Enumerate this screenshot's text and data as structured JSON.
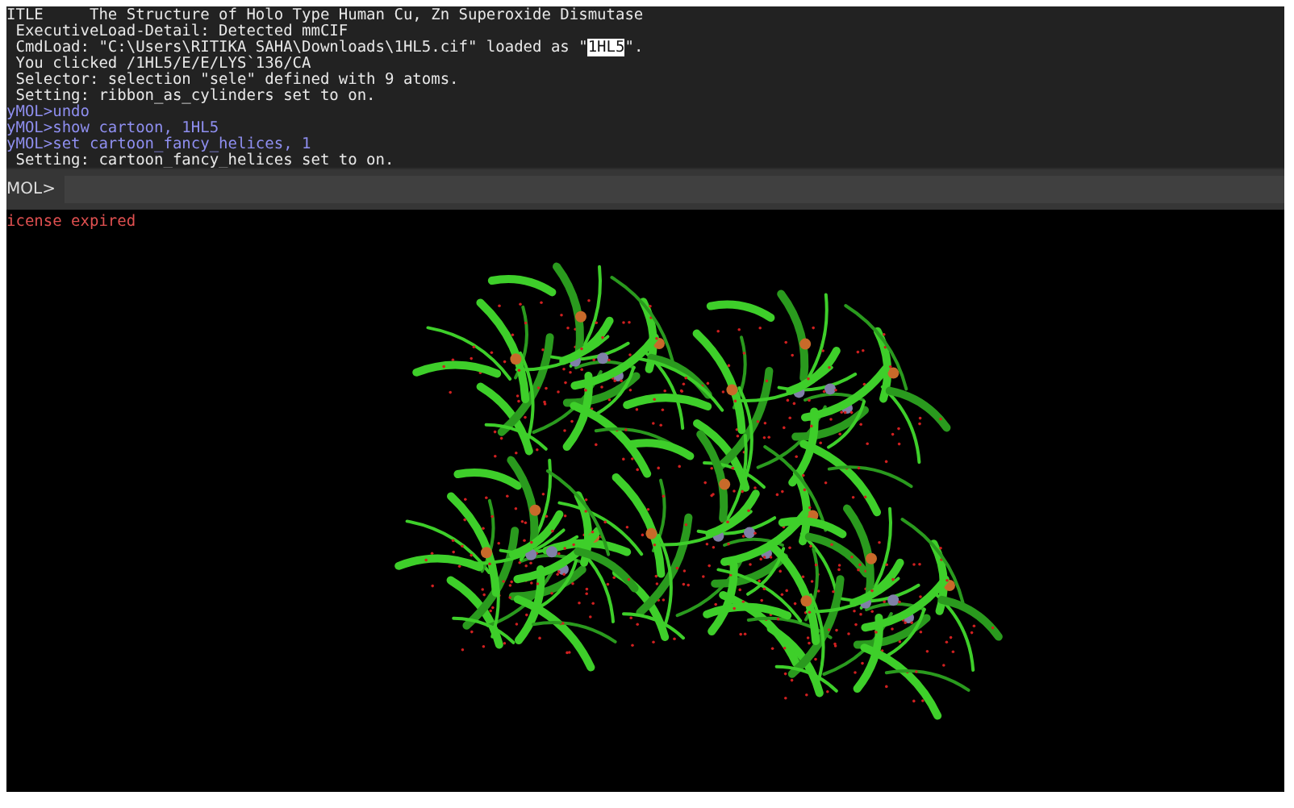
{
  "console": {
    "lines": [
      {
        "kind": "output",
        "parts": [
          {
            "text": "ITLE     The Structure of Holo Type Human Cu, Zn Superoxide Dismutase",
            "highlighted": false
          }
        ]
      },
      {
        "kind": "output",
        "parts": [
          {
            "text": " ExecutiveLoad-Detail: Detected mmCIF",
            "highlighted": false
          }
        ]
      },
      {
        "kind": "output",
        "parts": [
          {
            "text": " CmdLoad: \"C:\\Users\\RITIKA SAHA\\Downloads\\1HL5.cif\" loaded as \"",
            "highlighted": false
          },
          {
            "text": "1HL5",
            "highlighted": true
          },
          {
            "text": "\".",
            "highlighted": false
          }
        ]
      },
      {
        "kind": "output",
        "parts": [
          {
            "text": " You clicked /1HL5/E/E/LYS`136/CA",
            "highlighted": false
          }
        ]
      },
      {
        "kind": "output",
        "parts": [
          {
            "text": " Selector: selection \"sele\" defined with 9 atoms.",
            "highlighted": false
          }
        ]
      },
      {
        "kind": "output",
        "parts": [
          {
            "text": " Setting: ribbon_as_cylinders set to on.",
            "highlighted": false
          }
        ]
      },
      {
        "kind": "command",
        "parts": [
          {
            "text": "yMOL>undo",
            "highlighted": false
          }
        ]
      },
      {
        "kind": "command",
        "parts": [
          {
            "text": "yMOL>show cartoon, 1HL5",
            "highlighted": false
          }
        ]
      },
      {
        "kind": "command",
        "parts": [
          {
            "text": "yMOL>set cartoon_fancy_helices, 1",
            "highlighted": false
          }
        ]
      },
      {
        "kind": "output",
        "parts": [
          {
            "text": " Setting: cartoon_fancy_helices set to on.",
            "highlighted": false
          }
        ]
      }
    ]
  },
  "command_bar": {
    "prompt": "MOL>"
  },
  "viewer": {
    "message": "icense expired"
  }
}
